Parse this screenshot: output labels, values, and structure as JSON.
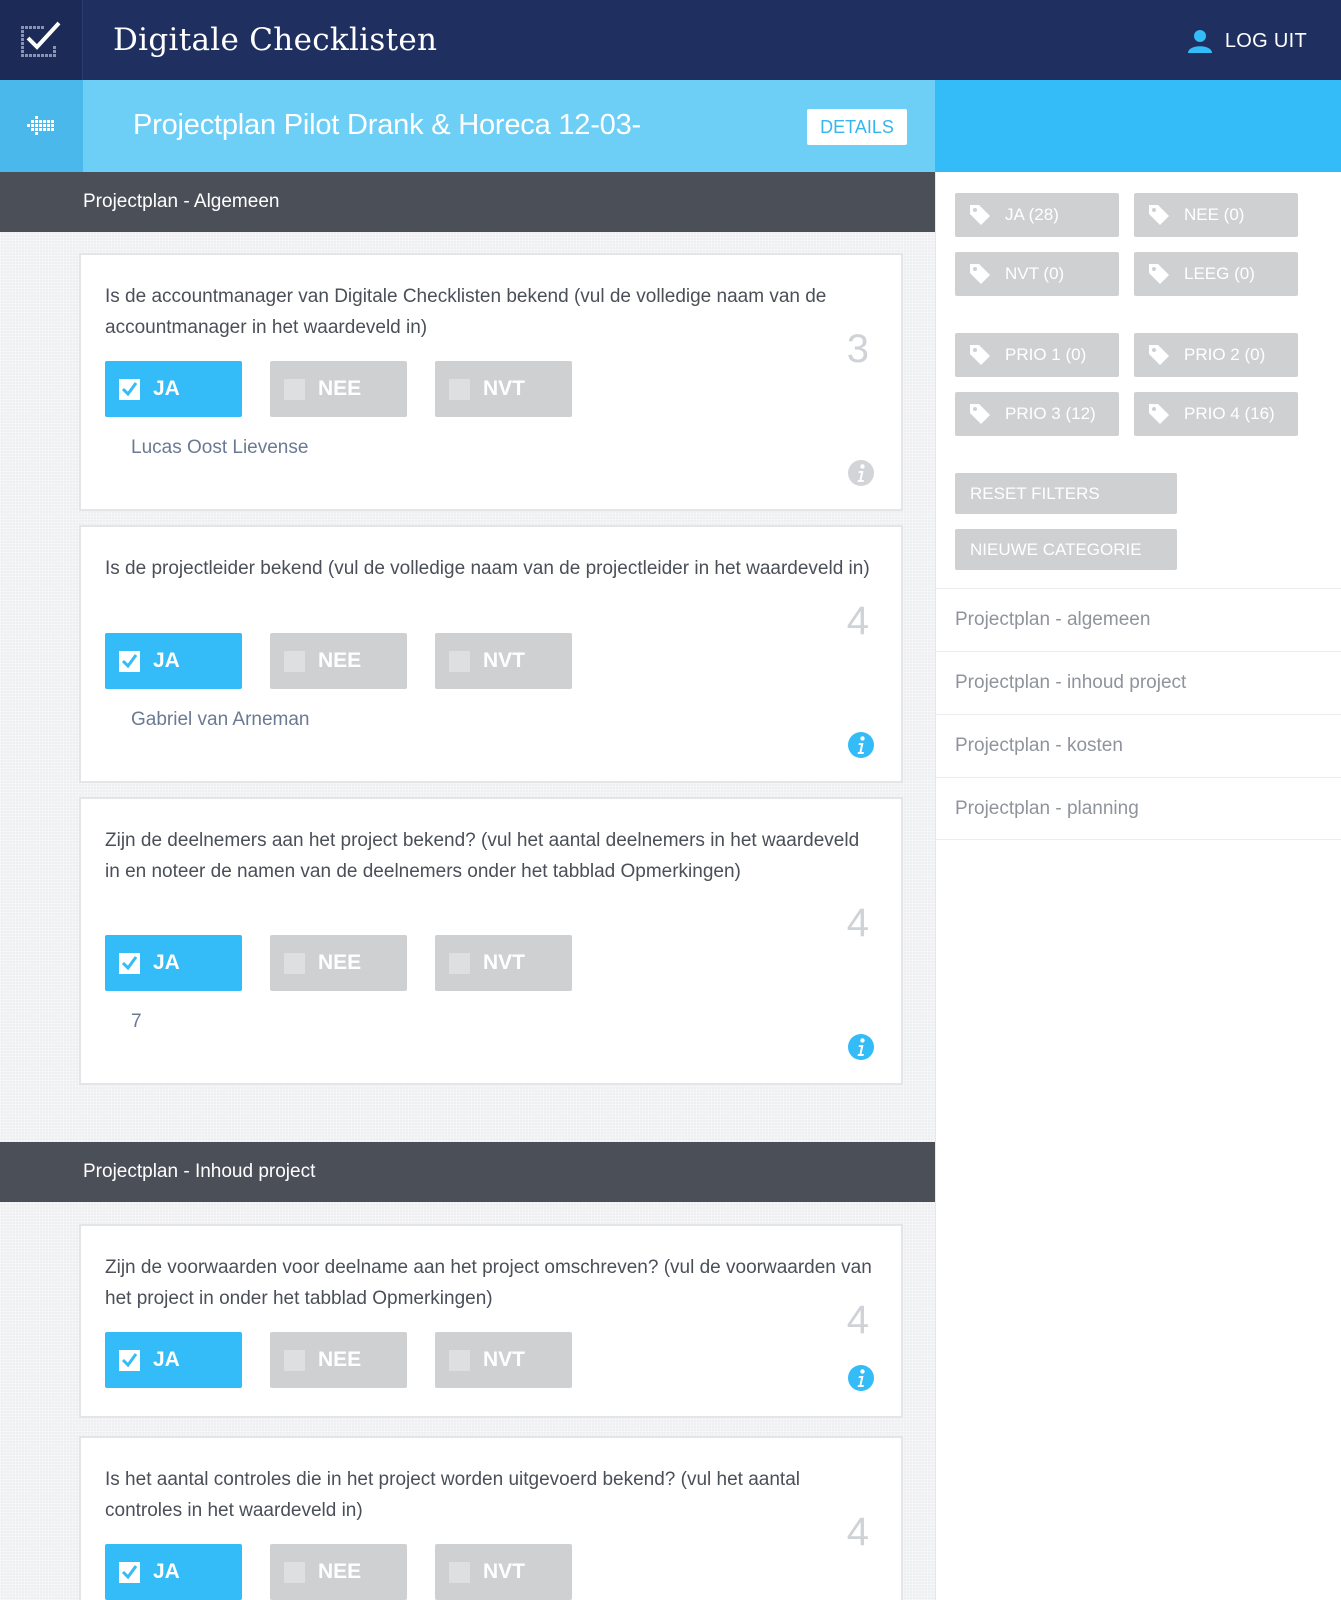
{
  "header": {
    "app_title": "Digitale Checklisten",
    "logout_label": "LOG UIT",
    "accent_color": "#1f2f60"
  },
  "project": {
    "title": "Projectplan Pilot Drank & Horeca 12-03-",
    "details_label": "DETAILS"
  },
  "sections": [
    {
      "title": "Projectplan - Algemeen",
      "questions": [
        {
          "text": "Is de accountmanager van Digitale Checklisten bekend (vul de volledige naam van de accountmanager in het waardeveld in)",
          "priority": "3",
          "selected": "JA",
          "value": "Lucas Oost Lievense",
          "info_active": false
        },
        {
          "text": "Is de projectleider bekend (vul de volledige naam van de projectleider in het waardeveld in)",
          "priority": "4",
          "selected": "JA",
          "value": "Gabriel van Arneman",
          "info_active": true
        },
        {
          "text": "Zijn de deelnemers aan het project bekend? (vul het aantal deelnemers in het waardeveld in en noteer de namen van de deelnemers onder het tabblad Opmerkingen)",
          "priority": "4",
          "selected": "JA",
          "value": "7",
          "info_active": true
        }
      ]
    },
    {
      "title": "Projectplan - Inhoud project",
      "questions": [
        {
          "text": "Zijn de voorwaarden voor deelname aan het project omschreven? (vul de voorwaarden van het project in onder het tabblad Opmerkingen)",
          "priority": "4",
          "selected": "JA",
          "value": "",
          "info_active": true
        },
        {
          "text": "Is het aantal controles die in het project worden uitgevoerd bekend? (vul het aantal controles in het waardeveld in)",
          "priority": "4",
          "selected": "JA",
          "value": "",
          "info_active": false
        }
      ]
    }
  ],
  "answers": {
    "yes": "JA",
    "no": "NEE",
    "na": "NVT"
  },
  "filters": {
    "status_tags": [
      "JA (28)",
      "NEE (0)",
      "NVT (0)",
      "LEEG (0)"
    ],
    "priority_tags": [
      "PRIO 1 (0)",
      "PRIO 2 (0)",
      "PRIO 3 (12)",
      "PRIO 4 (16)"
    ],
    "reset_label": "RESET FILTERS",
    "new_category_label": "NIEUWE CATEGORIE"
  },
  "categories": [
    "Projectplan - algemeen",
    "Projectplan - inhoud project",
    "Projectplan - kosten",
    "Projectplan - planning"
  ],
  "colors": {
    "active_answer": "#33bcf7",
    "inactive_answer": "#cfd0d2",
    "title_band": "#6ecff6",
    "section_header": "#4b4f58"
  },
  "icons": {
    "logo": "checkmark-logo-icon",
    "user": "user-icon",
    "back": "arrow-left-icon",
    "tag": "tag-icon",
    "info": "info-icon",
    "checkbox": "checkbox-icon"
  }
}
